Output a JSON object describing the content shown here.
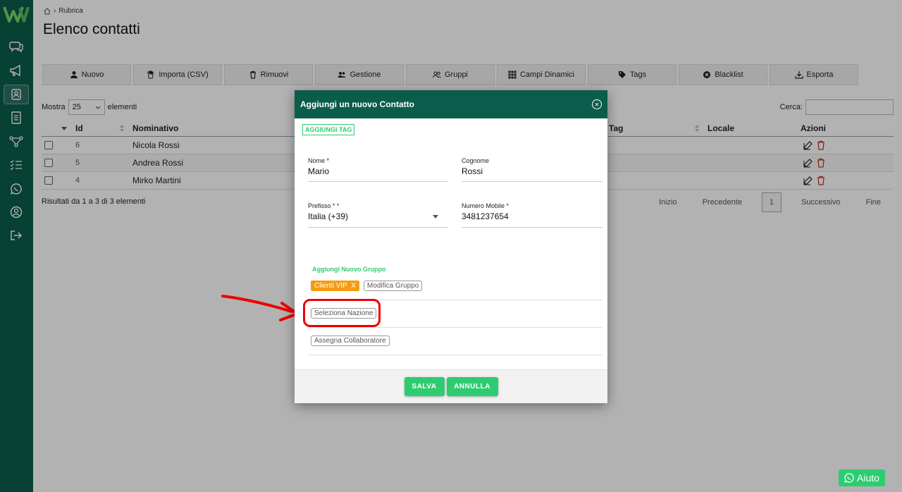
{
  "app": {
    "brand_color": "#0b5d4b",
    "accent": "#2ecc71"
  },
  "sidebar": {
    "items": [
      {
        "icon": "chat-icon"
      },
      {
        "icon": "megaphone-icon"
      },
      {
        "icon": "contacts-icon",
        "active": true
      },
      {
        "icon": "document-icon"
      },
      {
        "icon": "flow-icon"
      },
      {
        "icon": "checklist-icon"
      },
      {
        "icon": "whatsapp-icon"
      },
      {
        "icon": "user-icon"
      },
      {
        "icon": "logout-icon"
      }
    ]
  },
  "breadcrumb": {
    "label": "Rubrica"
  },
  "page_title": "Elenco contatti",
  "toolbar": {
    "buttons": [
      {
        "label": "Nuovo",
        "icon": "user-add-icon"
      },
      {
        "label": "Importa (CSV)",
        "icon": "hand-icon"
      },
      {
        "label": "Rimuovi",
        "icon": "trash-icon"
      },
      {
        "label": "Gestione",
        "icon": "users-icon"
      },
      {
        "label": "Gruppi",
        "icon": "group-icon"
      },
      {
        "label": "Campi Dinamici",
        "icon": "grid-icon"
      },
      {
        "label": "Tags",
        "icon": "tag-icon"
      },
      {
        "label": "Blacklist",
        "icon": "block-icon"
      },
      {
        "label": "Esporta",
        "icon": "export-icon"
      }
    ]
  },
  "table_controls": {
    "show_label": "Mostra",
    "show_value": "25",
    "elements_label": "elementi",
    "search_label": "Cerca:"
  },
  "table": {
    "headers": {
      "id": "Id",
      "name": "Nominativo",
      "tag": "Tag",
      "locale": "Locale",
      "actions": "Azioni"
    },
    "rows": [
      {
        "id": "6",
        "name": "Nicola Rossi"
      },
      {
        "id": "5",
        "name": "Andrea Rossi"
      },
      {
        "id": "4",
        "name": "Mirko Martini"
      }
    ]
  },
  "footer": {
    "results": "Risultati da 1 a 3 di 3 elementi",
    "first": "Inizio",
    "prev": "Precedente",
    "page": "1",
    "next": "Successivo",
    "last": "Fine"
  },
  "modal": {
    "title": "Aggiungi un nuovo Contatto",
    "add_tag": "AGGIUNGI TAG",
    "first_name_label": "Nome *",
    "first_name_value": "Mario",
    "last_name_label": "Cognome",
    "last_name_value": "Rossi",
    "prefix_label": "Prefisso * *",
    "prefix_value": "Italia (+39)",
    "mobile_label": "Numero Mobile *",
    "mobile_value": "3481237654",
    "add_group": "Aggiungi Nuovo Gruppo",
    "group_chip": "Clienti VIP",
    "group_chip_remove": "X",
    "edit_group": "Modifica Gruppo",
    "select_nation": "Seleziona Nazione",
    "assign_collaborator": "Assegna Collaboratore",
    "save": "SALVA",
    "cancel": "ANNULLA"
  },
  "help_button": "Aiuto"
}
